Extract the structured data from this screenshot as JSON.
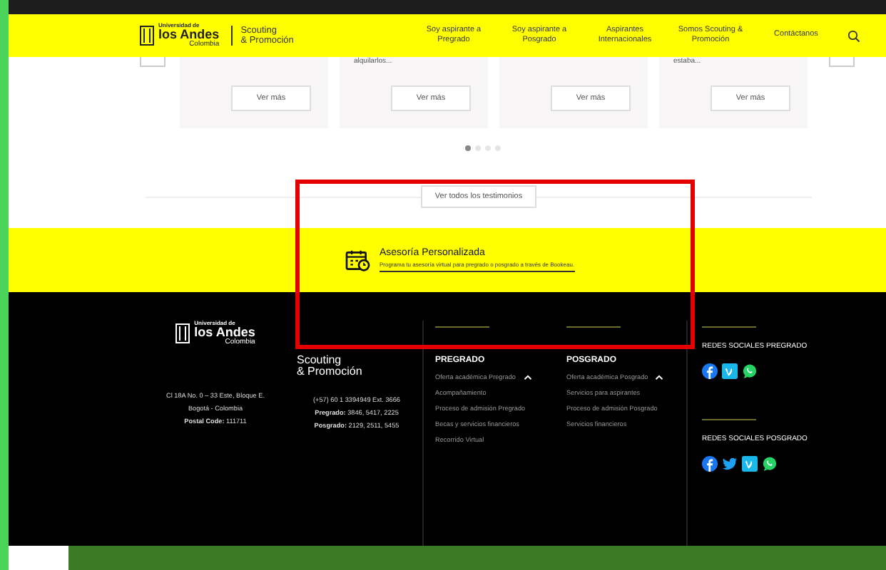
{
  "header": {
    "logo": {
      "line1": "Universidad de",
      "line2": "los Andes",
      "line3": "Colombia"
    },
    "brand": [
      "Scouting",
      "& Promoción"
    ],
    "nav": [
      {
        "label": "Soy aspirante a Pregrado"
      },
      {
        "label": "Soy aspirante a Posgrado"
      },
      {
        "label": "Aspirantes Internacionales"
      },
      {
        "label": "Somos Scouting & Promoción"
      },
      {
        "label": "Contáctanos"
      }
    ]
  },
  "testimonials": {
    "cards": [
      {
        "button": "Ver más"
      },
      {
        "snippet": "alquilarlos...",
        "button": "Ver más"
      },
      {
        "button": "Ver más"
      },
      {
        "snippet": "estaba...",
        "button": "Ver más"
      }
    ],
    "dots": [
      {
        "selected": true
      },
      {
        "selected": false
      },
      {
        "selected": false
      },
      {
        "selected": false
      }
    ],
    "all_button": "Ver todos los testimonios"
  },
  "advisory": {
    "title": "Asesoría Personalizada",
    "text": "Programa tu asesoría virtual para pregrado o posgrado a través de Bookeau."
  },
  "footer": {
    "logo": {
      "line1": "Universidad de",
      "line2": "los Andes",
      "line3": "Colombia"
    },
    "brand": [
      "Scouting",
      "& Promoción"
    ],
    "address": [
      "Cl 18A No. 0 – 33 Este, Bloque E.",
      "Bogotá - Colombia",
      "**Postal Code:** 111711"
    ],
    "phones": [
      "(+57) 60 1 3394949 Ext. 3666",
      "**Pregrado:** 3846, 5417, 2225",
      "**Posgrado:** 2129, 2511, 5455"
    ],
    "menus": [
      {
        "heading": "PREGRADO",
        "expanded": true,
        "links": [
          "Oferta académica Pregrado",
          "Acompañamiento",
          "Proceso de admisión Pregrado",
          "Becas y servicios financieros",
          "Recorrido Virtual"
        ]
      },
      {
        "heading": "POSGRADO",
        "expanded": true,
        "links": [
          "Oferta académica Posgrado",
          "Servicios para aspirantes",
          "Proceso de admisión Posgrado",
          "Servicios financieros"
        ]
      }
    ],
    "social": [
      {
        "title": "REDES SOCIALES PREGRADO",
        "icons": [
          {
            "kind": "facebook"
          },
          {
            "kind": "vimeo"
          },
          {
            "kind": "whatsapp"
          }
        ]
      },
      {
        "title": "REDES SOCIALES POSGRADO",
        "icons": [
          {
            "kind": "facebook"
          },
          {
            "kind": "twitter"
          },
          {
            "kind": "vimeo"
          },
          {
            "kind": "whatsapp"
          }
        ]
      }
    ]
  }
}
